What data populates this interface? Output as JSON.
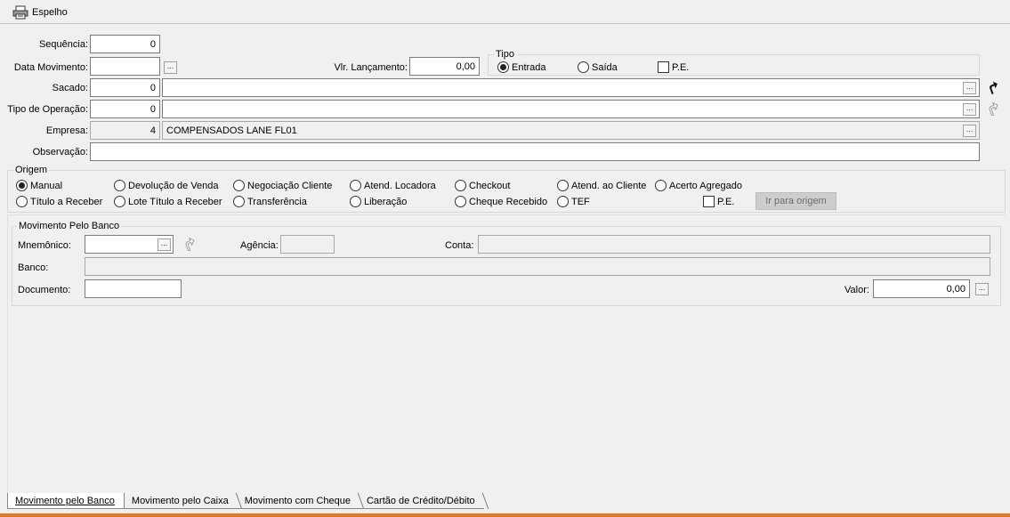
{
  "toolbar": {
    "espelho_label": "Espelho"
  },
  "form": {
    "sequencia": {
      "label": "Sequência:",
      "value": "0"
    },
    "data_movimento": {
      "label": "Data Movimento:",
      "value": ""
    },
    "vlr_lancamento": {
      "label": "Vlr. Lançamento:",
      "value": "0,00"
    },
    "sacado": {
      "label": "Sacado:",
      "code": "0",
      "name": ""
    },
    "tipo_operacao": {
      "label": "Tipo de Operação:",
      "code": "0",
      "name": ""
    },
    "empresa": {
      "label": "Empresa:",
      "code": "4",
      "name": "COMPENSADOS LANE FL01"
    },
    "observacao": {
      "label": "Observação:",
      "value": ""
    },
    "ellipsis": "...",
    "tipo": {
      "title": "Tipo",
      "entrada": "Entrada",
      "saida": "Saída",
      "pe": "P.E.",
      "selected": "Entrada"
    }
  },
  "origem": {
    "title": "Origem",
    "options_row1": [
      "Manual",
      "Devolução de Venda",
      "Negociação Cliente",
      "Atend. Locadora",
      "Checkout",
      "Atend. ao Cliente",
      "Acerto Agregado"
    ],
    "options_row2": [
      "Título a Receber",
      "Lote Título a Receber",
      "Transferência",
      "Liberação",
      "Cheque Recebido",
      "TEF"
    ],
    "selected": "Manual",
    "pe": "P.E.",
    "ir_para_origem": "Ir para origem"
  },
  "movimento_banco": {
    "title": "Movimento Pelo Banco",
    "mnemonico_label": "Mnemônico:",
    "agencia_label": "Agência:",
    "conta_label": "Conta:",
    "banco_label": "Banco:",
    "documento_label": "Documento:",
    "valor_label": "Valor:",
    "valor": "0,00"
  },
  "tabs": [
    "Movimento pelo Banco",
    "Movimento pelo Caixa",
    "Movimento com Cheque",
    "Cartão de Crédito/Débito"
  ],
  "colors": {
    "accent_bottom": "#e87722"
  }
}
